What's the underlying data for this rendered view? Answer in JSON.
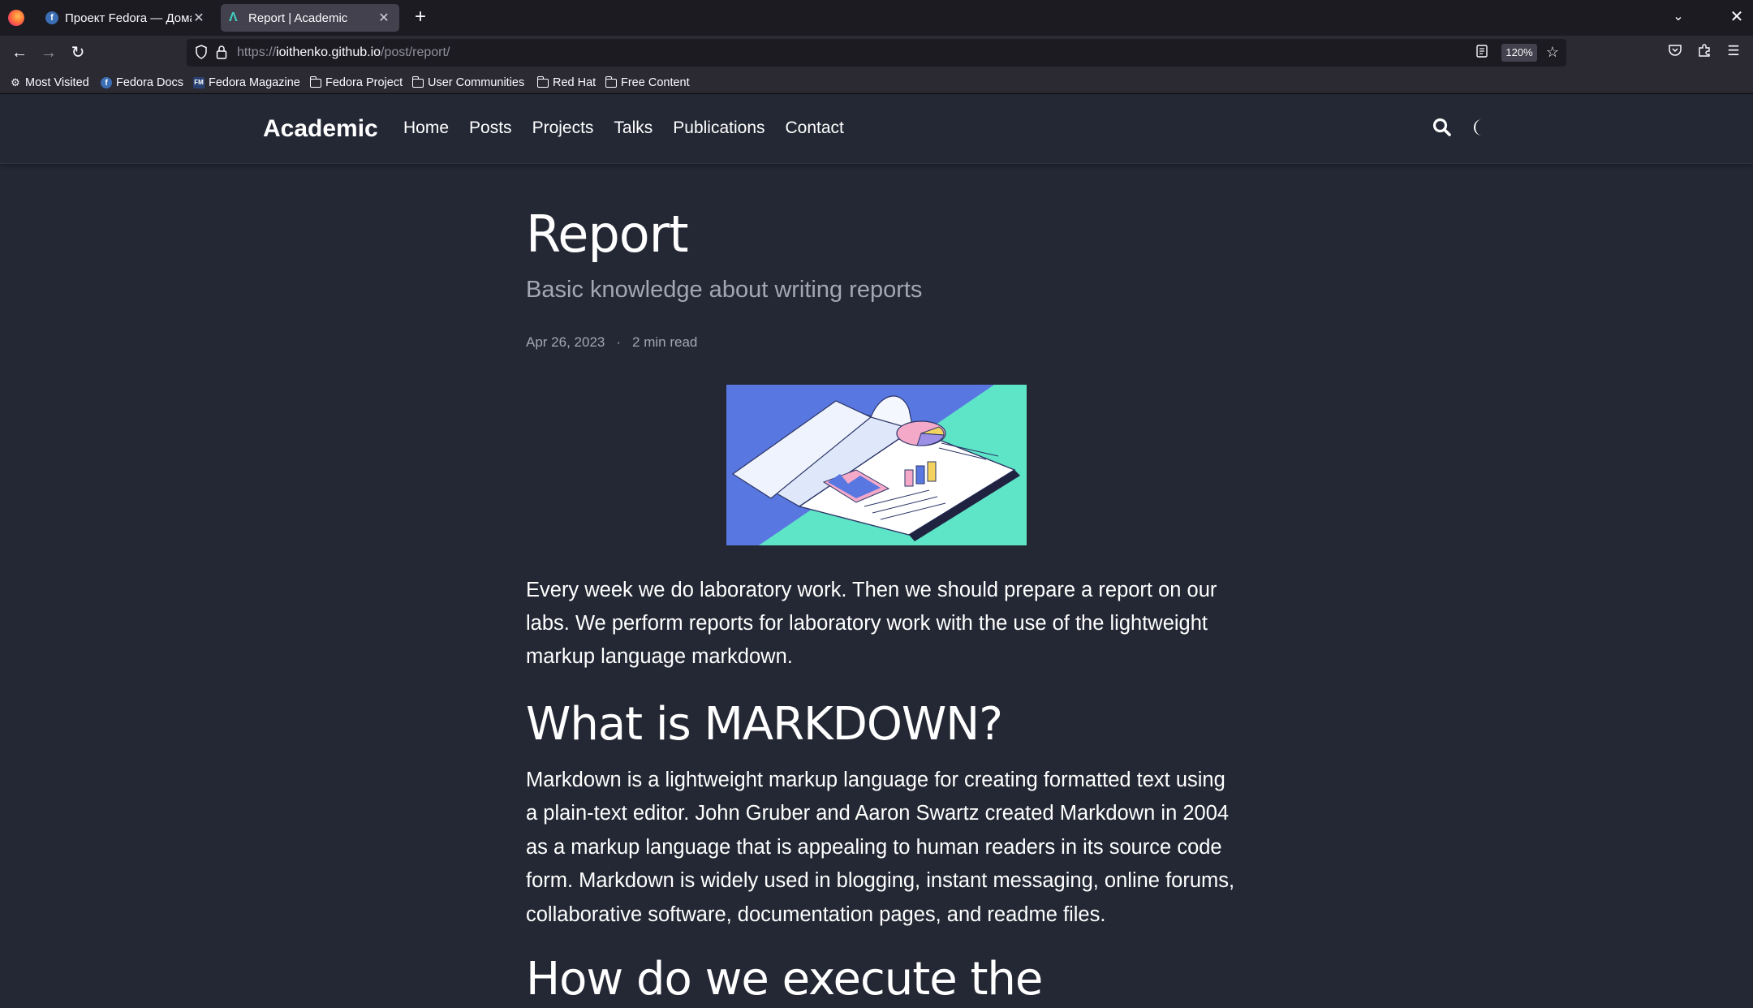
{
  "browser": {
    "tabs": [
      {
        "title": "Проект Fedora — Домашняя страница",
        "active": false
      },
      {
        "title": "Report | Academic",
        "active": true
      }
    ],
    "url": {
      "prefix": "https://",
      "host": "ioithenko.github.io",
      "path": "/post/report/"
    },
    "zoom": "120%",
    "bookmarks": [
      "Most Visited",
      "Fedora Docs",
      "Fedora Magazine",
      "Fedora Project",
      "User Communities",
      "Red Hat",
      "Free Content"
    ]
  },
  "site": {
    "brand": "Academic",
    "menu": [
      "Home",
      "Posts",
      "Projects",
      "Talks",
      "Publications",
      "Contact"
    ]
  },
  "post": {
    "title": "Report",
    "subtitle": "Basic knowledge about writing reports",
    "date": "Apr 26, 2023",
    "separator": "·",
    "read_time": "2 min read",
    "intro": "Every week we do laboratory work. Then we should prepare a report on our labs. We perform reports for laboratory work with the use of the lightweight markup language markdown.",
    "heading1": "What is MARKDOWN?",
    "paragraph1": "Markdown is a lightweight markup language for creating formatted text using a plain-text editor. John Gruber and Aaron Swartz created Markdown in 2004 as a markup language that is appealing to human readers in its source code form. Markdown is widely used in blogging, instant messaging, online forums, collaborative software, documentation pages, and readme files.",
    "heading2": "How do we execute the"
  },
  "colors": {
    "page_bg": "#242834",
    "tabbar_bg": "#1c1b22",
    "toolbar_bg": "#2b2a33",
    "muted_text": "#a3a7b3",
    "hero_blue": "#5877e0",
    "hero_mint": "#5ee5c7"
  }
}
